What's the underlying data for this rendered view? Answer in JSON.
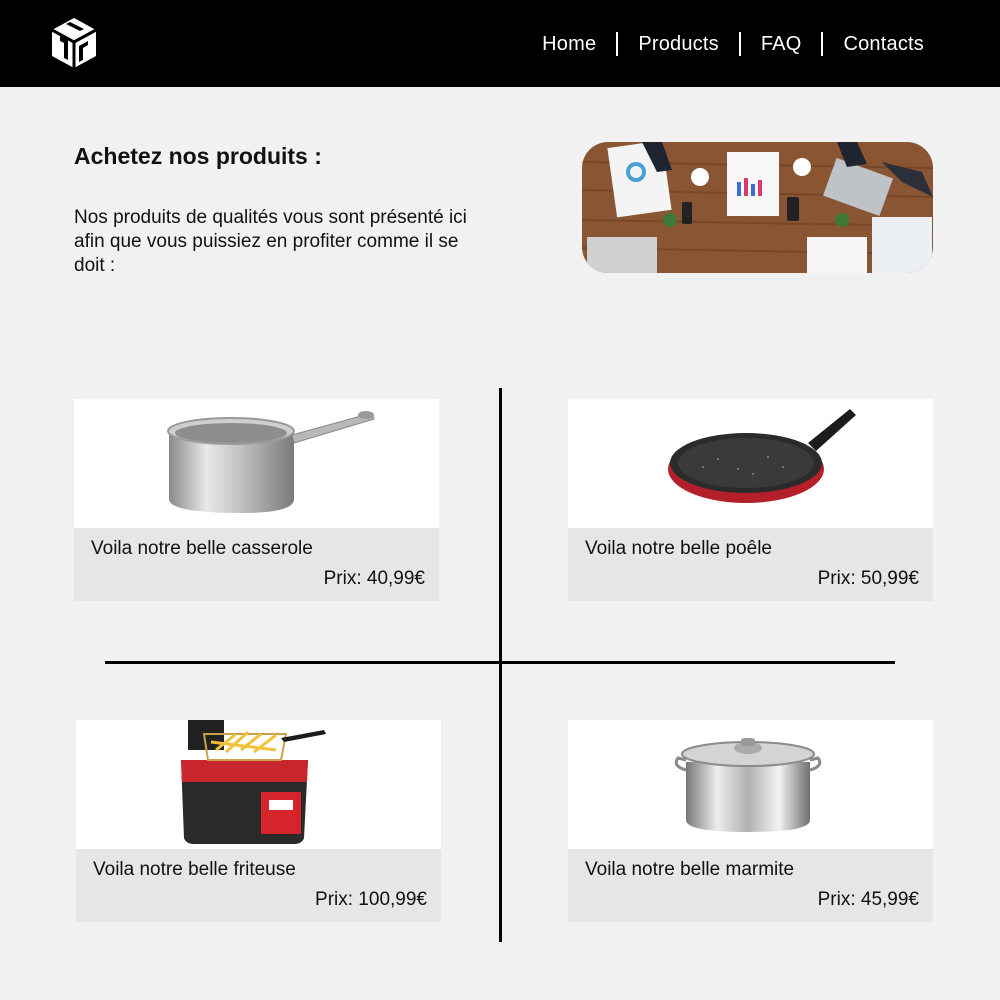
{
  "nav": {
    "logo_icon": "box-logo-icon",
    "items": [
      {
        "label": "Home"
      },
      {
        "label": "Products"
      },
      {
        "label": "FAQ"
      },
      {
        "label": "Contacts"
      }
    ]
  },
  "hero": {
    "title": "Achetez nos produits :",
    "text": "Nos produits de qualités vous sont présenté ici afin que vous puissiez en profiter comme il se doit :",
    "image": "business-meeting-photo"
  },
  "products": [
    {
      "name": "Voila notre belle casserole",
      "price": "Prix: 40,99€",
      "image": "saucepan-image"
    },
    {
      "name": "Voila notre belle poêle",
      "price": "Prix: 50,99€",
      "image": "frying-pan-image"
    },
    {
      "name": "Voila notre belle friteuse",
      "price": "Prix: 100,99€",
      "image": "deep-fryer-image"
    },
    {
      "name": "Voila notre belle marmite",
      "price": "Prix: 45,99€",
      "image": "stockpot-image"
    }
  ],
  "colors": {
    "navbar": "#000000",
    "background": "#f1f1f1",
    "card_footer": "#e6e6e6"
  }
}
